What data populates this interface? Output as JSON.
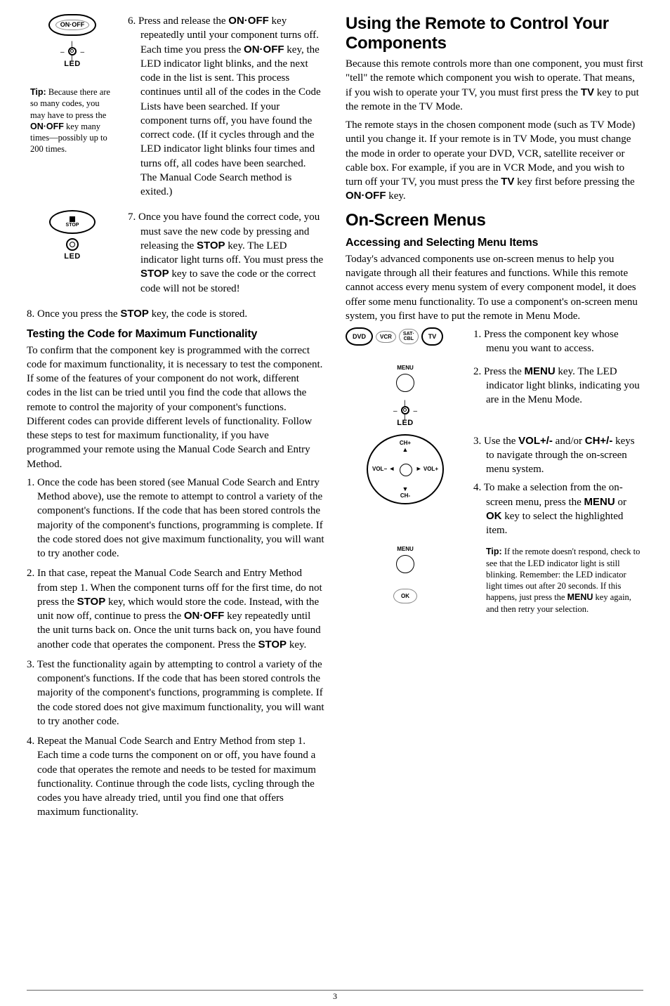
{
  "left": {
    "onoff_icon": "ON·OFF",
    "led_label": "LED",
    "tip1": {
      "bold": "Tip:",
      "rest": " Because there are so many codes, you may have to press the ",
      "key": "ON·OFF",
      "rest2": " key many times—possibly up to 200 times."
    },
    "step6": {
      "num": "6. ",
      "a": "Press and release the ",
      "k1": "ON·OFF",
      "b": " key repeatedly until your component turns off. Each time you press the ",
      "k2": "ON·OFF",
      "c": " key, the LED indicator light blinks, and the next code in the list is sent. This process continues until all of the codes in the Code Lists have been searched. If your component turns off, you have found the correct code. (If it cycles through and the LED indicator light blinks four times and turns off, all codes have been searched. The Manual Code Search method is exited.)"
    },
    "stop_label": "STOP",
    "step7": {
      "num": "7. ",
      "a": "Once you have found the correct code, you must save the new code by pressing and releasing the ",
      "k1": "STOP",
      "b": " key. The LED indicator light turns off. You must press the ",
      "k2": "STOP",
      "c": " key to save the code or the correct code will not be stored!"
    },
    "step8": {
      "num": "8. ",
      "a": "Once you press the ",
      "k1": "STOP",
      "b": " key, the code is stored."
    },
    "h_test": "Testing the Code for Maximum Functionality",
    "p_test": "To confirm that the component key is programmed with the correct code for maximum functionality, it is necessary to test the component. If some of the features of your component do not work, different codes in the list can be tried until you find the code that allows the remote to control the majority of your component's functions. Different codes can provide different levels of functionality. Follow these steps to test for maximum functionality, if you have programmed your remote using the Manual Code Search and Entry Method.",
    "li1": "Once the code has been stored (see Manual Code Search and Entry Method above), use the remote to attempt to control a variety of the component's functions. If the code that has been stored controls the majority of the component's functions, programming is complete. If the code stored does not give maximum functionality, you will want to try another code.",
    "li2": {
      "a": "In that case, repeat the Manual Code Search and Entry Method from step 1. When the component turns off for the first time, do not press the ",
      "k1": "STOP",
      "b": " key, which would store the code. Instead, with the unit now off, continue to press the ",
      "k2": "ON·OFF",
      "c": " key repeatedly until the unit turns back on. Once the unit turns back on, you have found another code that operates the component. Press the ",
      "k3": "STOP",
      "d": " key."
    },
    "li3": "Test the functionality again by attempting to control a variety of the component's functions. If the code that has been stored controls the majority of the component's functions, programming is complete. If the code stored does not give maximum functionality, you will want to try another code.",
    "li4": "Repeat the Manual Code Search and Entry Method from step 1. Each time a code turns the component on or off, you have found a code that operates the remote and needs to be tested for maximum functionality. Continue through the code lists, cycling through the codes you have already tried, until you find one that offers maximum functionality."
  },
  "right": {
    "h1": "Using the Remote to Control Your Components",
    "p1": {
      "a": "Because this remote controls more than one component, you must first \"tell\" the remote which component you wish to operate. That means, if you wish to operate your TV, you must first press the ",
      "k1": "TV",
      "b": " key to put the remote in the TV Mode."
    },
    "p2": {
      "a": "The remote stays in the chosen component mode (such as TV Mode) until you change it. If your remote is in TV Mode, you must change the mode in order to operate your DVD, VCR, satellite receiver or cable box. For example, if you are in VCR Mode, and you wish to turn off your TV, you must press the ",
      "k1": "TV",
      "b": " key first before pressing the ",
      "k2": "ON·OFF",
      "c": " key."
    },
    "h2": "On-Screen Menus",
    "h3": "Accessing and Selecting Menu Items",
    "p3": "Today's advanced components use on-screen menus to help you navigate through all their features and functions. While this remote cannot access every menu system of every component model, it does offer some menu functionality. To use a component's on-screen menu system, you first have to put the remote in Menu Mode.",
    "keys": {
      "dvd": "DVD",
      "vcr": "VCR",
      "sat": "SAT·\nCBL",
      "tv": "TV",
      "menu": "MENU",
      "ok": "OK"
    },
    "nav": {
      "ch_plus": "CH+",
      "ch_minus": "CH-",
      "vol_plus": "VOL+",
      "vol_minus": "VOL−"
    },
    "led_label": "LED",
    "s1": {
      "num": "1. ",
      "t": "Press the component key whose menu you want to access."
    },
    "s2": {
      "num": "2. ",
      "a": "Press the ",
      "k1": "MENU",
      "b": " key. The LED indicator light blinks, indicating you are in the Menu Mode."
    },
    "s3": {
      "num": "3. ",
      "a": "Use the ",
      "k1": "VOL+/-",
      "b": " and/or ",
      "k2": "CH+/-",
      "c": " keys to navigate through the on-screen menu system."
    },
    "s4": {
      "num": "4. ",
      "a": "To make a selection from the on-screen menu, press the ",
      "k1": "MENU",
      "b": " or ",
      "k2": "OK",
      "c": " key to select the highlighted item."
    },
    "tip2": {
      "bold": "Tip:",
      "a": " If the remote doesn't respond, check to see that the LED indicator light is still blinking. Remember: the LED indicator light times out after 20 seconds. If this happens, just press the ",
      "k1": "MENU",
      "b": " key again, and then retry your selection."
    }
  },
  "page": "3"
}
